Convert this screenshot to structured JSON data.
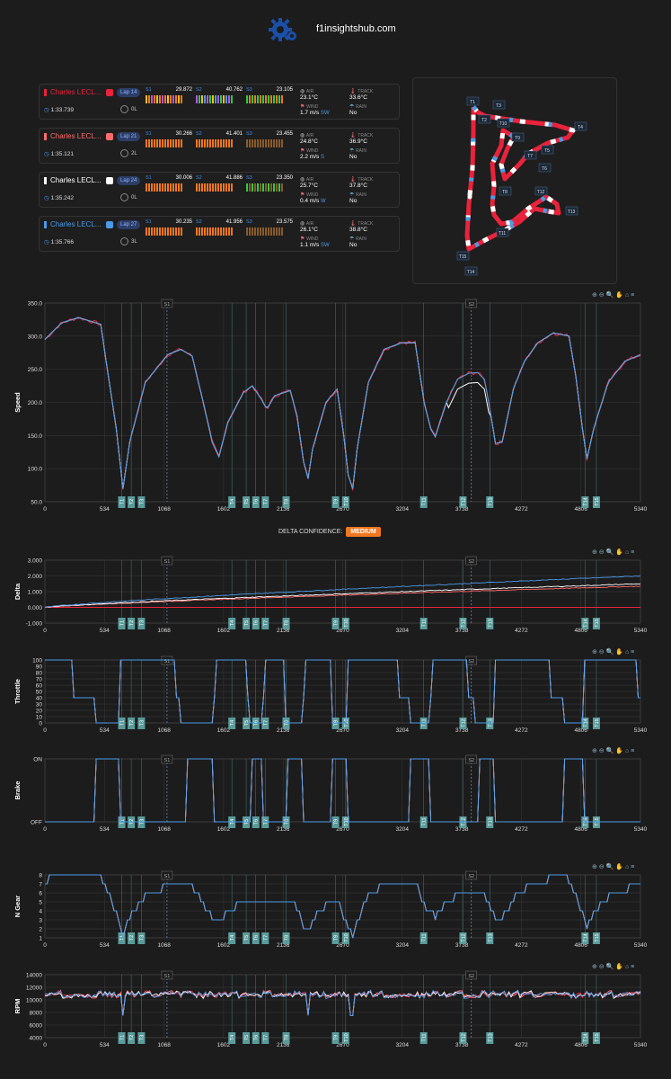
{
  "header": {
    "site": "f1insightshub.com"
  },
  "colors": {
    "red": "#e8233c",
    "pink": "#ff6b6b",
    "white": "#ffffff",
    "blue": "#4a9be8",
    "purple": "#b855e6",
    "green": "#2ecc40",
    "yellow": "#f4c20d",
    "orange": "#f07820",
    "grid": "#3a3a3a"
  },
  "drivers": [
    {
      "name": "Charles LECL...",
      "color": "#e8233c",
      "lap": "Lap 14",
      "time": "1:33.739",
      "tyre": "0L",
      "s1": "29.872",
      "s2": "40.762",
      "s3": "23.105",
      "air": "23.1°C",
      "track": "33.6°C",
      "wind": "1.7 m/s",
      "wind_dir": "SW",
      "rain": "No"
    },
    {
      "name": "Charles LECL...",
      "color": "#ff6b6b",
      "lap": "Lap 21",
      "time": "1:35.121",
      "tyre": "2L",
      "s1": "30.266",
      "s2": "41.401",
      "s3": "23.455",
      "air": "24.8°C",
      "track": "36.9°C",
      "wind": "2.2 m/s",
      "wind_dir": "S",
      "rain": "No"
    },
    {
      "name": "Charles LECL...",
      "color": "#ffffff",
      "lap": "Lap 24",
      "time": "1:35.242",
      "tyre": "0L",
      "s1": "30.006",
      "s2": "41.886",
      "s3": "23.350",
      "air": "25.7°C",
      "track": "37.8°C",
      "wind": "0.4 m/s",
      "wind_dir": "W",
      "rain": "No"
    },
    {
      "name": "Charles LECL...",
      "color": "#4a9be8",
      "lap": "Lap 27",
      "time": "1:35.766",
      "tyre": "3L",
      "s1": "30.235",
      "s2": "41.956",
      "s3": "23.575",
      "air": "26.1°C",
      "track": "38.8°C",
      "wind": "1.1 m/s",
      "wind_dir": "SW",
      "rain": "No"
    }
  ],
  "labels": {
    "s1": "S1",
    "s2": "S2",
    "s3": "S3",
    "air": "AIR",
    "track": "TRACK",
    "wind": "WIND",
    "rain": "RAIN"
  },
  "track_map": {
    "turns": [
      "T1",
      "T2",
      "T3",
      "T4",
      "T5",
      "T6",
      "T7",
      "T8",
      "T9",
      "T10",
      "T11",
      "T12",
      "T13",
      "T14",
      "T15"
    ]
  },
  "delta_confidence": {
    "label": "DELTA CONFIDENCE:",
    "value": "MEDIUM"
  },
  "chart_data": [
    {
      "type": "line",
      "ylabel": "Speed",
      "ylim": [
        50,
        350
      ],
      "yticks": [
        "50.0",
        "100.0",
        "150.0",
        "200.0",
        "250.0",
        "300.0",
        "350.0"
      ],
      "xlim": [
        0,
        5340
      ],
      "xticks": [
        "0",
        "534",
        "1068",
        "1602",
        "2136",
        "2670",
        "3204",
        "3738",
        "4272",
        "4806",
        "5340"
      ],
      "corners": [
        "T1",
        "T2",
        "T3",
        "T4",
        "T5",
        "T6",
        "T7",
        "T8",
        "T9",
        "T10",
        "T11",
        "T12",
        "T13",
        "T14",
        "T15"
      ],
      "sector_markers": [
        "S1",
        "S2"
      ],
      "series": [
        {
          "color": "#e8233c"
        },
        {
          "color": "#ff6b6b"
        },
        {
          "color": "#ffffff"
        },
        {
          "color": "#4a9be8"
        }
      ]
    },
    {
      "type": "line",
      "ylabel": "Delta",
      "ylim": [
        -1,
        3
      ],
      "yticks": [
        "-1.000",
        "0.000",
        "1.000",
        "2.000",
        "3.000"
      ]
    },
    {
      "type": "line",
      "ylabel": "Throttle",
      "ylim": [
        0,
        100
      ],
      "yticks": [
        "0",
        "10",
        "20",
        "30",
        "40",
        "50",
        "60",
        "70",
        "80",
        "90",
        "100"
      ]
    },
    {
      "type": "line",
      "ylabel": "Brake",
      "yticks": [
        "OFF",
        "ON"
      ]
    },
    {
      "type": "line",
      "ylabel": "N Gear",
      "ylim": [
        1,
        8
      ],
      "yticks": [
        "1",
        "2",
        "3",
        "4",
        "5",
        "6",
        "7",
        "8"
      ]
    },
    {
      "type": "line",
      "ylabel": "RPM",
      "ylim": [
        4000,
        14000
      ],
      "yticks": [
        "4000",
        "6000",
        "8000",
        "10000",
        "12000",
        "14000"
      ]
    }
  ]
}
